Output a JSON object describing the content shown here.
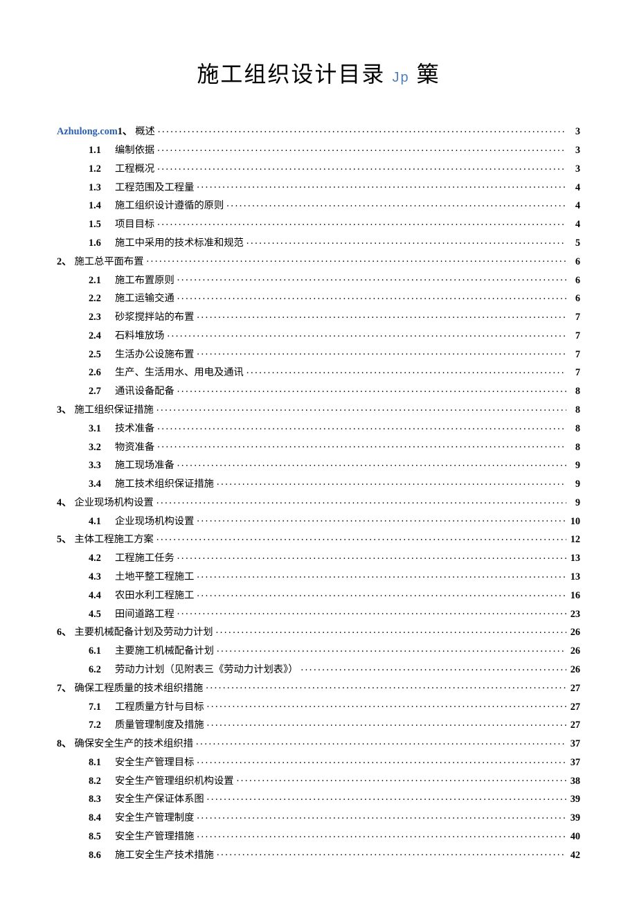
{
  "title_main": "施工组织设计目录",
  "title_suffix_small": "Jp",
  "title_suffix_char": "篥",
  "toc": [
    {
      "level": 0,
      "num_html": "<span class='link-color'>A</span><span class='link-color'>zhulong.com</span>1、",
      "label": "概述",
      "page": "3",
      "label_after_space": true
    },
    {
      "level": 1,
      "num": "1.1",
      "label": "编制依据",
      "page": "3",
      "label_after_space": true
    },
    {
      "level": 1,
      "num": "1.2",
      "label": "工程概况",
      "page": "3",
      "label_after_space": true
    },
    {
      "level": 1,
      "num": "1.3",
      "label": "工程范围及工程量",
      "page": "4",
      "label_after_space": true
    },
    {
      "level": 1,
      "num": "1.4",
      "label": "施工组织设计遵循的原则",
      "page": "4",
      "label_after_space": true
    },
    {
      "level": 1,
      "num": "1.5",
      "label": "项目目标",
      "page": "4",
      "label_after_space": true
    },
    {
      "level": 1,
      "num": "1.6",
      "label": "施工中采用的技术标准和规范",
      "page": "5",
      "label_after_space": true
    },
    {
      "level": 0,
      "num": "2、",
      "label": "施工总平面布置",
      "page": "6"
    },
    {
      "level": 1,
      "num": "2.1",
      "label": "施工布置原则",
      "page": "6",
      "label_after_space": true
    },
    {
      "level": 1,
      "num": "2.2",
      "label": "施工运输交通",
      "page": "6",
      "label_after_space": true
    },
    {
      "level": 1,
      "num": "2.3",
      "label": "砂浆搅拌站的布置",
      "page": "7",
      "label_after_space": true
    },
    {
      "level": 1,
      "num": "2.4",
      "label": "石料堆放场",
      "page": "7",
      "label_after_space": true
    },
    {
      "level": 1,
      "num": "2.5",
      "label": "生活办公设施布置",
      "page": "7",
      "label_after_space": true
    },
    {
      "level": 1,
      "num": "2.6",
      "label": "生产、生活用水、用电及通讯",
      "page": "7",
      "label_after_space": true
    },
    {
      "level": 1,
      "num": "2.7",
      "label": "通讯设备配备",
      "page": "8",
      "label_after_space": true
    },
    {
      "level": 0,
      "num": "3、",
      "label": "施工组织保证措施",
      "page": "8"
    },
    {
      "level": 1,
      "num": "3.1",
      "label": "技术准备",
      "page": "8",
      "label_after_space": true
    },
    {
      "level": 1,
      "num": "3.2",
      "label": "物资准备",
      "page": "8",
      "label_after_space": true
    },
    {
      "level": 1,
      "num": "3.3",
      "label": "施工现场准备",
      "page": "9",
      "label_after_space": true
    },
    {
      "level": 1,
      "num": "3.4",
      "label": "施工技术组织保证措施",
      "page": "9",
      "label_after_space": true
    },
    {
      "level": 0,
      "num": "4、",
      "label": "企业现场机构设置",
      "page": "9"
    },
    {
      "level": 1,
      "num": "4.1",
      "label": "企业现场机构设置",
      "page": "10",
      "label_after_space": true
    },
    {
      "level": 0,
      "num": "5、",
      "label": "主体工程施工方案",
      "page": "12"
    },
    {
      "level": 1,
      "num": "4.2",
      "label": "工程施工任务",
      "page": "13",
      "label_after_space": true
    },
    {
      "level": 1,
      "num": "4.3",
      "label": "土地平整工程施工",
      "page": "13"
    },
    {
      "level": 1,
      "num": "4.4",
      "label": "农田水利工程施工",
      "page": "16"
    },
    {
      "level": 1,
      "num": "4.5",
      "label": "田间道路工程",
      "page": "23",
      "label_after_space": true
    },
    {
      "level": 0,
      "num": "6、",
      "label": "主要机械配备计划及劳动力计划",
      "page": "26"
    },
    {
      "level": 1,
      "num": "6.1",
      "label": "主要施工机械配备计划",
      "page": "26",
      "label_after_space": true
    },
    {
      "level": 1,
      "num": "6.2",
      "label": "劳动力计划（见附表三《劳动力计划表》）",
      "page": "26",
      "label_after_space": true
    },
    {
      "level": 0,
      "num": "7、",
      "label": "确保工程质量的技术组织措施",
      "page": "27"
    },
    {
      "level": 1,
      "num": "7.1",
      "label": "工程质量方针与目标",
      "page": "27",
      "label_after_space": true
    },
    {
      "level": 1,
      "num": "7.2",
      "label": "质量管理制度及措施",
      "page": "27",
      "label_after_space": true
    },
    {
      "level": 0,
      "num": "8、",
      "label": "确保安全生产的技术组织措",
      "page": "37"
    },
    {
      "level": 1,
      "num": "8.1",
      "label": "安全生产管理目标",
      "page": "37",
      "label_after_space": true
    },
    {
      "level": 1,
      "num": "8.2",
      "label": "安全生产管理组织机构设置",
      "page": "38",
      "label_after_space": true
    },
    {
      "level": 1,
      "num": "8.3",
      "label": "安全生产保证体系图",
      "page": "39",
      "label_after_space": true
    },
    {
      "level": 1,
      "num": "8.4",
      "label": "安全生产管理制度",
      "page": "39",
      "label_after_space": true
    },
    {
      "level": 1,
      "num": "8.5",
      "label": "安全生产管理措施",
      "page": "40",
      "label_after_space": true
    },
    {
      "level": 1,
      "num": "8.6",
      "label": "施工安全生产技术措施",
      "page": "42",
      "label_after_space": true
    }
  ]
}
